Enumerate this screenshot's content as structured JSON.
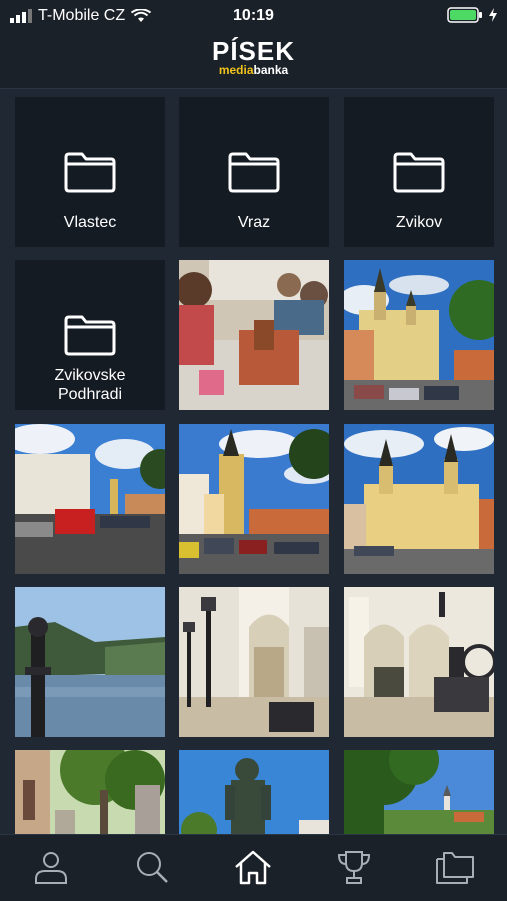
{
  "status_bar": {
    "carrier": "T-Mobile CZ",
    "time": "10:19"
  },
  "header": {
    "title": "PÍSEK",
    "subtitle_part1": "media",
    "subtitle_part2": "banka"
  },
  "folders": [
    {
      "label": "Vlastec"
    },
    {
      "label": "Vraz"
    },
    {
      "label": "Zvikov"
    },
    {
      "label": "Zvikovske\nPodhradi"
    }
  ],
  "photos": [
    {
      "subject": "children-with-model"
    },
    {
      "subject": "town-hall-square"
    },
    {
      "subject": "street-with-cars"
    },
    {
      "subject": "square-with-tower"
    },
    {
      "subject": "town-hall-facade"
    },
    {
      "subject": "river-landscape"
    },
    {
      "subject": "museum-hall-lamps"
    },
    {
      "subject": "museum-hall-machine"
    },
    {
      "subject": "garden-sculpture"
    },
    {
      "subject": "statue"
    },
    {
      "subject": "trees-landscape"
    }
  ],
  "tabbar": {
    "items": [
      {
        "name": "profile-icon"
      },
      {
        "name": "search-icon"
      },
      {
        "name": "home-icon",
        "active": true
      },
      {
        "name": "trophy-icon"
      },
      {
        "name": "gallery-icon"
      }
    ]
  },
  "colors": {
    "background": "#1f2833",
    "tile": "#151b23",
    "accent": "#f0c21b"
  }
}
